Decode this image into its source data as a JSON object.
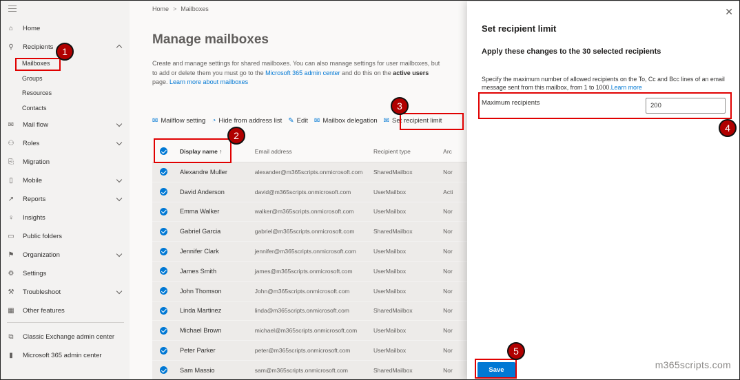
{
  "sidebar": {
    "items": [
      {
        "label": "Home",
        "icon": "home-icon"
      },
      {
        "label": "Recipients",
        "icon": "person-icon"
      },
      {
        "label": "Mail flow",
        "icon": "mail-icon"
      },
      {
        "label": "Roles",
        "icon": "roles-icon"
      },
      {
        "label": "Migration",
        "icon": "migration-icon"
      },
      {
        "label": "Mobile",
        "icon": "mobile-icon"
      },
      {
        "label": "Reports",
        "icon": "chart-icon"
      },
      {
        "label": "Insights",
        "icon": "lightbulb-icon"
      },
      {
        "label": "Public folders",
        "icon": "folder-icon"
      },
      {
        "label": "Organization",
        "icon": "organization-icon"
      },
      {
        "label": "Settings",
        "icon": "gear-icon"
      },
      {
        "label": "Troubleshoot",
        "icon": "wrench-icon"
      },
      {
        "label": "Other features",
        "icon": "grid-icon"
      }
    ],
    "recipients_sub": [
      "Mailboxes",
      "Groups",
      "Resources",
      "Contacts"
    ],
    "bottom_links": [
      {
        "label": "Classic Exchange admin center",
        "icon": "exchange-icon"
      },
      {
        "label": "Microsoft 365 admin center",
        "icon": "office-icon"
      }
    ]
  },
  "breadcrumb": {
    "home": "Home",
    "separator": ">",
    "current": "Mailboxes"
  },
  "page": {
    "title": "Manage mailboxes",
    "desc_part1": "Create and manage settings for shared mailboxes. You can also manage settings for user mailboxes, but to add or delete them you must go to the ",
    "desc_link1": "Microsoft 365 admin center",
    "desc_part2": " and do this on the ",
    "desc_bold": "active users",
    "desc_part3": " page. ",
    "desc_link2": "Learn more about mailboxes"
  },
  "toolbar": {
    "mailflow": "Mailflow setting",
    "hide": "Hide from address list",
    "edit": "Edit",
    "delegation": "Mailbox delegation",
    "set_limit": "Set recipient limit"
  },
  "table": {
    "headers": {
      "name": "Display name",
      "sort": "↑",
      "email": "Email address",
      "type": "Recipient type",
      "archive": "Arc"
    },
    "rows": [
      {
        "name": "Alexandre Muller",
        "email": "alexander@m365scripts.onmicrosoft.com",
        "type": "SharedMailbox",
        "archive": "Nor"
      },
      {
        "name": "David Anderson",
        "email": "david@m365scripts.onmicrosoft.com",
        "type": "UserMailbox",
        "archive": "Acti"
      },
      {
        "name": "Emma Walker",
        "email": "walker@m365scripts.onmicrosoft.com",
        "type": "UserMailbox",
        "archive": "Nor"
      },
      {
        "name": "Gabriel Garcia",
        "email": "gabriel@m365scripts.onmicrosoft.com",
        "type": "SharedMailbox",
        "archive": "Nor"
      },
      {
        "name": "Jennifer Clark",
        "email": "jennifer@m365scripts.onmicrosoft.com",
        "type": "UserMailbox",
        "archive": "Nor"
      },
      {
        "name": "James Smith",
        "email": "james@m365scripts.onmicrosoft.com",
        "type": "UserMailbox",
        "archive": "Nor"
      },
      {
        "name": "John Thomson",
        "email": "John@m365scripts.onmicrosoft.com",
        "type": "UserMailbox",
        "archive": "Nor"
      },
      {
        "name": "Linda Martinez",
        "email": "linda@m365scripts.onmicrosoft.com",
        "type": "SharedMailbox",
        "archive": "Nor"
      },
      {
        "name": "Michael Brown",
        "email": "michael@m365scripts.onmicrosoft.com",
        "type": "UserMailbox",
        "archive": "Nor"
      },
      {
        "name": "Peter Parker",
        "email": "peter@m365scripts.onmicrosoft.com",
        "type": "UserMailbox",
        "archive": "Nor"
      },
      {
        "name": "Sam Massio",
        "email": "sam@m365scripts.onmicrosoft.com",
        "type": "SharedMailbox",
        "archive": "Nor"
      }
    ]
  },
  "panel": {
    "title": "Set recipient limit",
    "subtitle": "Apply these changes to the 30 selected recipients",
    "desc": "Specify the maximum number of allowed recipients on the To, Cc and Bcc lines of an email message sent from this mailbox, from 1 to 1000.",
    "learn_more": "Learn more",
    "max_label": "Maximum recipients",
    "max_value": "200",
    "save": "Save",
    "close": "✕"
  },
  "annotations": [
    "1",
    "2",
    "3",
    "4",
    "5"
  ],
  "watermark": "m365scripts.com",
  "colors": {
    "accent": "#0078d4",
    "highlight": "#e00000",
    "badge": "#b00000"
  }
}
